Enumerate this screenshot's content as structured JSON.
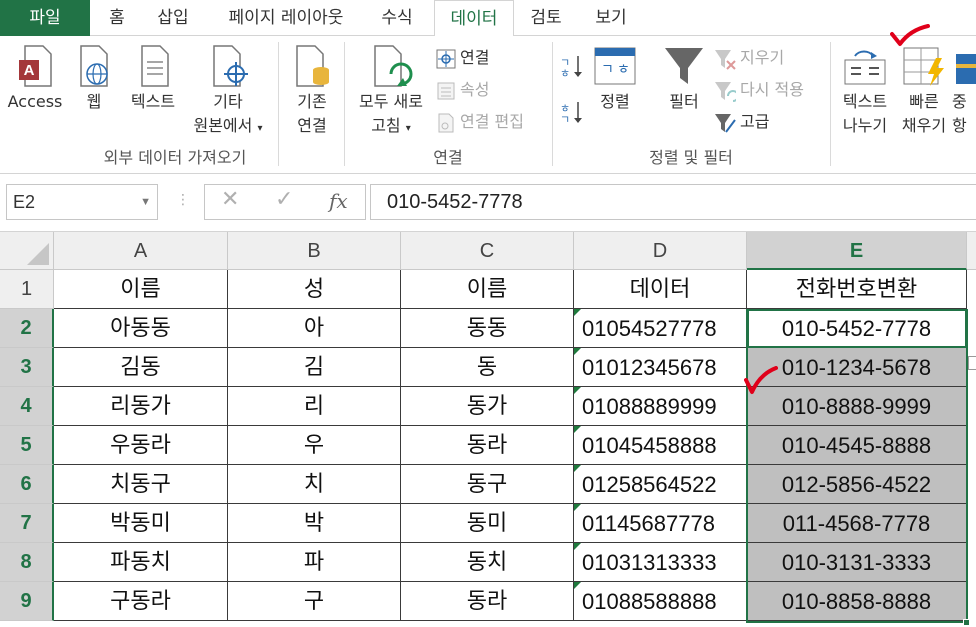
{
  "tabs": [
    {
      "label": "파일"
    },
    {
      "label": "홈"
    },
    {
      "label": "삽입"
    },
    {
      "label": "페이지 레이아웃"
    },
    {
      "label": "수식"
    },
    {
      "label": "데이터"
    },
    {
      "label": "검토"
    },
    {
      "label": "보기"
    }
  ],
  "ribbon": {
    "external": {
      "access": "Access",
      "web": "웹",
      "text": "텍스트",
      "other_line1": "기타",
      "other_line2": "원본에서",
      "existing_line1": "기존",
      "existing_line2": "연결",
      "group_label": "외부 데이터 가져오기"
    },
    "connections": {
      "refresh_line1": "모두 새로",
      "refresh_line2": "고침",
      "connections": "연결",
      "properties": "속성",
      "edit_links": "연결 편집",
      "group_label": "연결"
    },
    "sort_filter": {
      "sort": "정렬",
      "filter": "필터",
      "clear": "지우기",
      "reapply": "다시 적용",
      "advanced": "고급",
      "group_label": "정렬 및 필터"
    },
    "tools": {
      "text_to_columns_line1": "텍스트",
      "text_to_columns_line2": "나누기",
      "flash_fill_line1": "빠른",
      "flash_fill_line2": "채우기",
      "remove_dup_line1": "중",
      "remove_dup_line2": "항"
    }
  },
  "formula_bar": {
    "name_box": "E2",
    "cancel_symbol": "✕",
    "enter_symbol": "✓",
    "fx_symbol": "fx",
    "value": "010-5452-7778"
  },
  "sheet": {
    "columns": [
      "A",
      "B",
      "C",
      "D",
      "E"
    ],
    "selected_column": "E",
    "active_cell": "E2",
    "rows": [
      {
        "num": "1",
        "cells": [
          "이름",
          "성",
          "이름",
          "데이터",
          "전화번호변환"
        ]
      },
      {
        "num": "2",
        "cells": [
          "아동동",
          "아",
          "동동",
          "01054527778",
          "010-5452-7778"
        ]
      },
      {
        "num": "3",
        "cells": [
          "김동",
          "김",
          "동",
          "01012345678",
          "010-1234-5678"
        ]
      },
      {
        "num": "4",
        "cells": [
          "리동가",
          "리",
          "동가",
          "01088889999",
          "010-8888-9999"
        ]
      },
      {
        "num": "5",
        "cells": [
          "우동라",
          "우",
          "동라",
          "01045458888",
          "010-4545-8888"
        ]
      },
      {
        "num": "6",
        "cells": [
          "치동구",
          "치",
          "동구",
          "01258564522",
          "012-5856-4522"
        ]
      },
      {
        "num": "7",
        "cells": [
          "박동미",
          "박",
          "동미",
          "01145687778",
          "011-4568-7778"
        ]
      },
      {
        "num": "8",
        "cells": [
          "파동치",
          "파",
          "동치",
          "01031313333",
          "010-3131-3333"
        ]
      },
      {
        "num": "9",
        "cells": [
          "구동라",
          "구",
          "동라",
          "01088588888",
          "010-8858-8888"
        ]
      }
    ]
  },
  "colors": {
    "accent": "#217346",
    "check_mark": "#e0001a",
    "selection_fill": "#bfbfbf"
  }
}
